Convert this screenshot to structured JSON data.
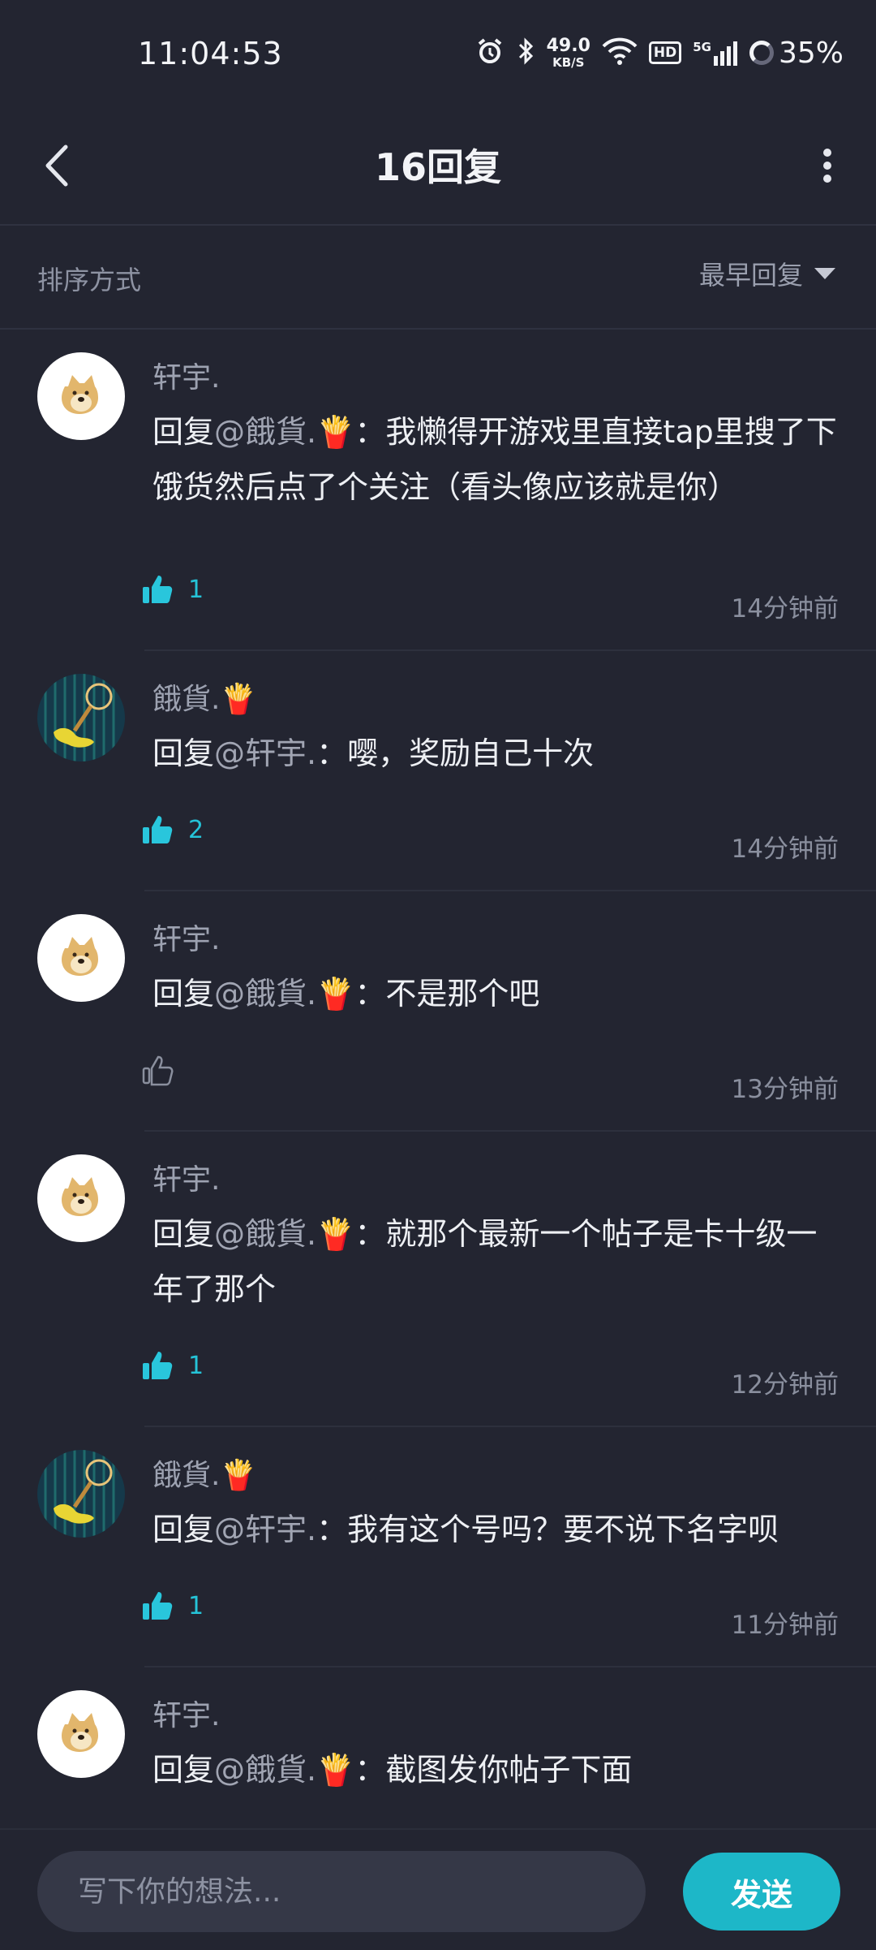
{
  "status_bar": {
    "time": "11:04:53",
    "net_speed_value": "49.0",
    "net_speed_unit": "KB/S",
    "hd_label": "HD",
    "signal_label": "5G",
    "battery": "35%"
  },
  "header": {
    "title": "16回复",
    "back_icon": "chevron-left-icon",
    "more_icon": "more-vertical-icon"
  },
  "sort": {
    "label": "排序方式",
    "selected": "最早回复"
  },
  "colors": {
    "background": "#232531",
    "accent": "#1db7c8",
    "like_active": "#29c6dc"
  },
  "replies": [
    {
      "user": "轩宇.",
      "avatar": "doge",
      "reply_prefix": "回复",
      "mention": "@餓貨.🍟",
      "text": "：我懒得开游戏里直接tap里搜了下饿货然后点了个关注（看头像应该就是你）",
      "likes": "1",
      "liked": true,
      "time": "14分钟前"
    },
    {
      "user": "餓貨.🍟",
      "avatar": "net",
      "reply_prefix": "回复",
      "mention": "@轩宇.",
      "text": "：嘤，奖励自己十次",
      "likes": "2",
      "liked": true,
      "time": "14分钟前"
    },
    {
      "user": "轩宇.",
      "avatar": "doge",
      "reply_prefix": "回复",
      "mention": "@餓貨.🍟",
      "text": "：不是那个吧",
      "likes": "",
      "liked": false,
      "time": "13分钟前"
    },
    {
      "user": "轩宇.",
      "avatar": "doge",
      "reply_prefix": "回复",
      "mention": "@餓貨.🍟",
      "text": "：就那个最新一个帖子是卡十级一年了那个",
      "likes": "1",
      "liked": true,
      "time": "12分钟前"
    },
    {
      "user": "餓貨.🍟",
      "avatar": "net",
      "reply_prefix": "回复",
      "mention": "@轩宇.",
      "text": "：我有这个号吗？要不说下名字呗",
      "likes": "1",
      "liked": true,
      "time": "11分钟前"
    },
    {
      "user": "轩宇.",
      "avatar": "doge",
      "reply_prefix": "回复",
      "mention": "@餓貨.🍟",
      "text": "：截图发你帖子下面",
      "likes": "",
      "liked": false,
      "time": ""
    }
  ],
  "composer": {
    "placeholder": "写下你的想法...",
    "send_label": "发送"
  }
}
